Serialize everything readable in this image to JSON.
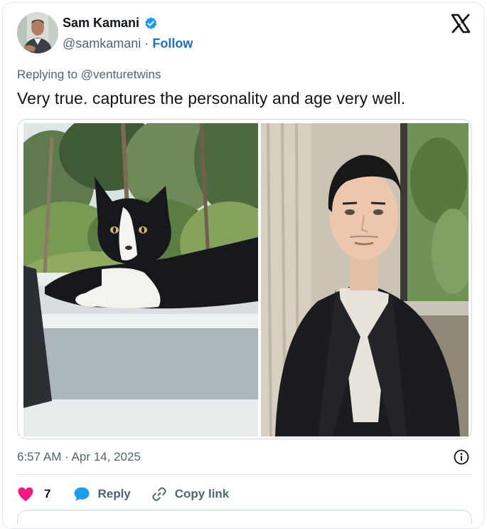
{
  "author": {
    "name": "Sam Kamani",
    "handle": "@samkamani",
    "separator": "·",
    "follow_label": "Follow",
    "verified_color": "#1d9bf0"
  },
  "reply": {
    "prefix": "Replying to",
    "mention": "@venturetwins"
  },
  "tweet": {
    "text": "Very true. captures the personality and age very well.",
    "timestamp": "6:57 AM · Apr 14, 2025"
  },
  "media": {
    "images": [
      "cat-photo",
      "man-portrait-photo"
    ]
  },
  "actions": {
    "like_count": "7",
    "reply_label": "Reply",
    "copy_link_label": "Copy link",
    "like_color": "#f91880",
    "reply_color": "#1d9bf0"
  }
}
